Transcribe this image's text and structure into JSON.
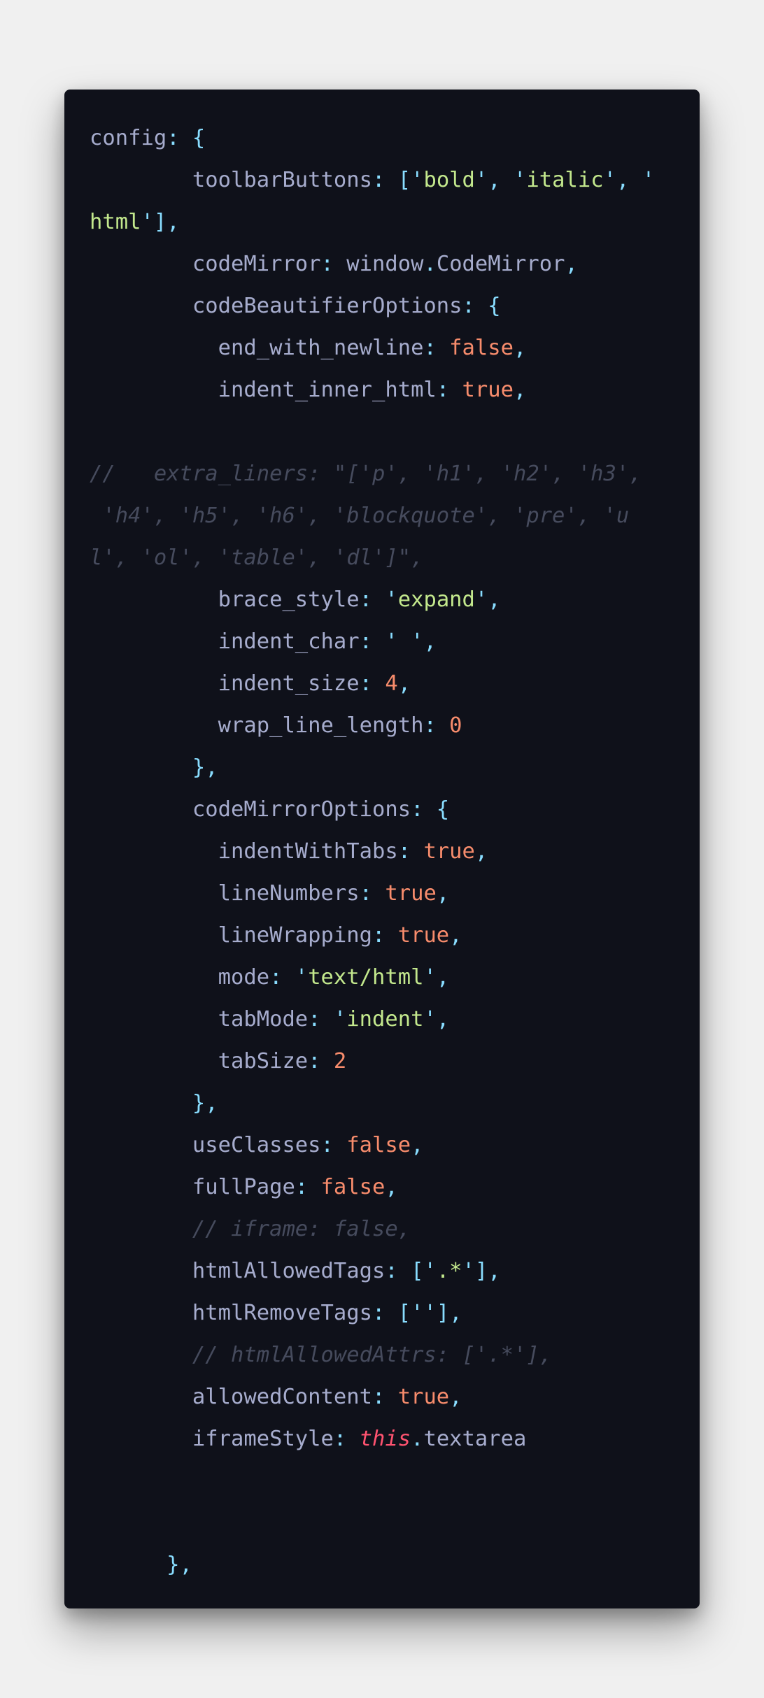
{
  "colors": {
    "background": "#f0f0f0",
    "editor_background": "#0f111a",
    "text": "#a6accd",
    "punctuation": "#89ddff",
    "string": "#c3e88d",
    "number_boolean": "#f78c6c",
    "comment": "#464b5d",
    "keyword_this": "#ff5370"
  },
  "code_lines": [
    [
      [
        "k",
        "config"
      ],
      [
        "p",
        ": {"
      ]
    ],
    [
      [
        "k",
        "        toolbarButtons"
      ],
      [
        "p",
        ": ["
      ],
      [
        "p",
        "'"
      ],
      [
        "s",
        "bold"
      ],
      [
        "p",
        "'"
      ],
      [
        "p",
        ", "
      ],
      [
        "p",
        "'"
      ],
      [
        "s",
        "italic"
      ],
      [
        "p",
        "'"
      ],
      [
        "p",
        ", "
      ],
      [
        "p",
        "'"
      ]
    ],
    [
      [
        "s",
        "html"
      ],
      [
        "p",
        "'"
      ],
      [
        "p",
        "],"
      ]
    ],
    [
      [
        "k",
        "        codeMirror"
      ],
      [
        "p",
        ": "
      ],
      [
        "k",
        "window"
      ],
      [
        "p",
        "."
      ],
      [
        "k",
        "CodeMirror"
      ],
      [
        "p",
        ","
      ]
    ],
    [
      [
        "k",
        "        codeBeautifierOptions"
      ],
      [
        "p",
        ": {"
      ]
    ],
    [
      [
        "k",
        "          end_with_newline"
      ],
      [
        "p",
        ": "
      ],
      [
        "n",
        "false"
      ],
      [
        "p",
        ","
      ]
    ],
    [
      [
        "k",
        "          indent_inner_html"
      ],
      [
        "p",
        ": "
      ],
      [
        "n",
        "true"
      ],
      [
        "p",
        ","
      ]
    ],
    [],
    [
      [
        "c",
        "//   extra_liners: \"['p', 'h1', 'h2', 'h3',"
      ]
    ],
    [
      [
        "c",
        " 'h4', 'h5', 'h6', 'blockquote', 'pre', 'u"
      ]
    ],
    [
      [
        "c",
        "l', 'ol', 'table', 'dl']\","
      ]
    ],
    [
      [
        "k",
        "          brace_style"
      ],
      [
        "p",
        ": "
      ],
      [
        "p",
        "'"
      ],
      [
        "s",
        "expand"
      ],
      [
        "p",
        "'"
      ],
      [
        "p",
        ","
      ]
    ],
    [
      [
        "k",
        "          indent_char"
      ],
      [
        "p",
        ": "
      ],
      [
        "p",
        "'"
      ],
      [
        "s",
        " "
      ],
      [
        "p",
        "'"
      ],
      [
        "p",
        ","
      ]
    ],
    [
      [
        "k",
        "          indent_size"
      ],
      [
        "p",
        ": "
      ],
      [
        "n",
        "4"
      ],
      [
        "p",
        ","
      ]
    ],
    [
      [
        "k",
        "          wrap_line_length"
      ],
      [
        "p",
        ": "
      ],
      [
        "n",
        "0"
      ]
    ],
    [
      [
        "p",
        "        },"
      ]
    ],
    [
      [
        "k",
        "        codeMirrorOptions"
      ],
      [
        "p",
        ": {"
      ]
    ],
    [
      [
        "k",
        "          indentWithTabs"
      ],
      [
        "p",
        ": "
      ],
      [
        "n",
        "true"
      ],
      [
        "p",
        ","
      ]
    ],
    [
      [
        "k",
        "          lineNumbers"
      ],
      [
        "p",
        ": "
      ],
      [
        "n",
        "true"
      ],
      [
        "p",
        ","
      ]
    ],
    [
      [
        "k",
        "          lineWrapping"
      ],
      [
        "p",
        ": "
      ],
      [
        "n",
        "true"
      ],
      [
        "p",
        ","
      ]
    ],
    [
      [
        "k",
        "          mode"
      ],
      [
        "p",
        ": "
      ],
      [
        "p",
        "'"
      ],
      [
        "s",
        "text/html"
      ],
      [
        "p",
        "'"
      ],
      [
        "p",
        ","
      ]
    ],
    [
      [
        "k",
        "          tabMode"
      ],
      [
        "p",
        ": "
      ],
      [
        "p",
        "'"
      ],
      [
        "s",
        "indent"
      ],
      [
        "p",
        "'"
      ],
      [
        "p",
        ","
      ]
    ],
    [
      [
        "k",
        "          tabSize"
      ],
      [
        "p",
        ": "
      ],
      [
        "n",
        "2"
      ]
    ],
    [
      [
        "p",
        "        },"
      ]
    ],
    [
      [
        "k",
        "        useClasses"
      ],
      [
        "p",
        ": "
      ],
      [
        "n",
        "false"
      ],
      [
        "p",
        ","
      ]
    ],
    [
      [
        "k",
        "        fullPage"
      ],
      [
        "p",
        ": "
      ],
      [
        "n",
        "false"
      ],
      [
        "p",
        ","
      ]
    ],
    [
      [
        "c",
        "        // iframe: false,"
      ]
    ],
    [
      [
        "k",
        "        htmlAllowedTags"
      ],
      [
        "p",
        ": ["
      ],
      [
        "p",
        "'"
      ],
      [
        "s",
        ".*"
      ],
      [
        "p",
        "'"
      ],
      [
        "p",
        "],"
      ]
    ],
    [
      [
        "k",
        "        htmlRemoveTags"
      ],
      [
        "p",
        ": ["
      ],
      [
        "p",
        "''"
      ],
      [
        "p",
        "],"
      ]
    ],
    [
      [
        "c",
        "        // htmlAllowedAttrs: ['.*'],"
      ]
    ],
    [
      [
        "k",
        "        allowedContent"
      ],
      [
        "p",
        ": "
      ],
      [
        "n",
        "true"
      ],
      [
        "p",
        ","
      ]
    ],
    [
      [
        "k",
        "        iframeStyle"
      ],
      [
        "p",
        ": "
      ],
      [
        "t",
        "this"
      ],
      [
        "p",
        "."
      ],
      [
        "k",
        "textarea"
      ]
    ],
    [],
    [],
    [
      [
        "p",
        "      },"
      ]
    ]
  ]
}
